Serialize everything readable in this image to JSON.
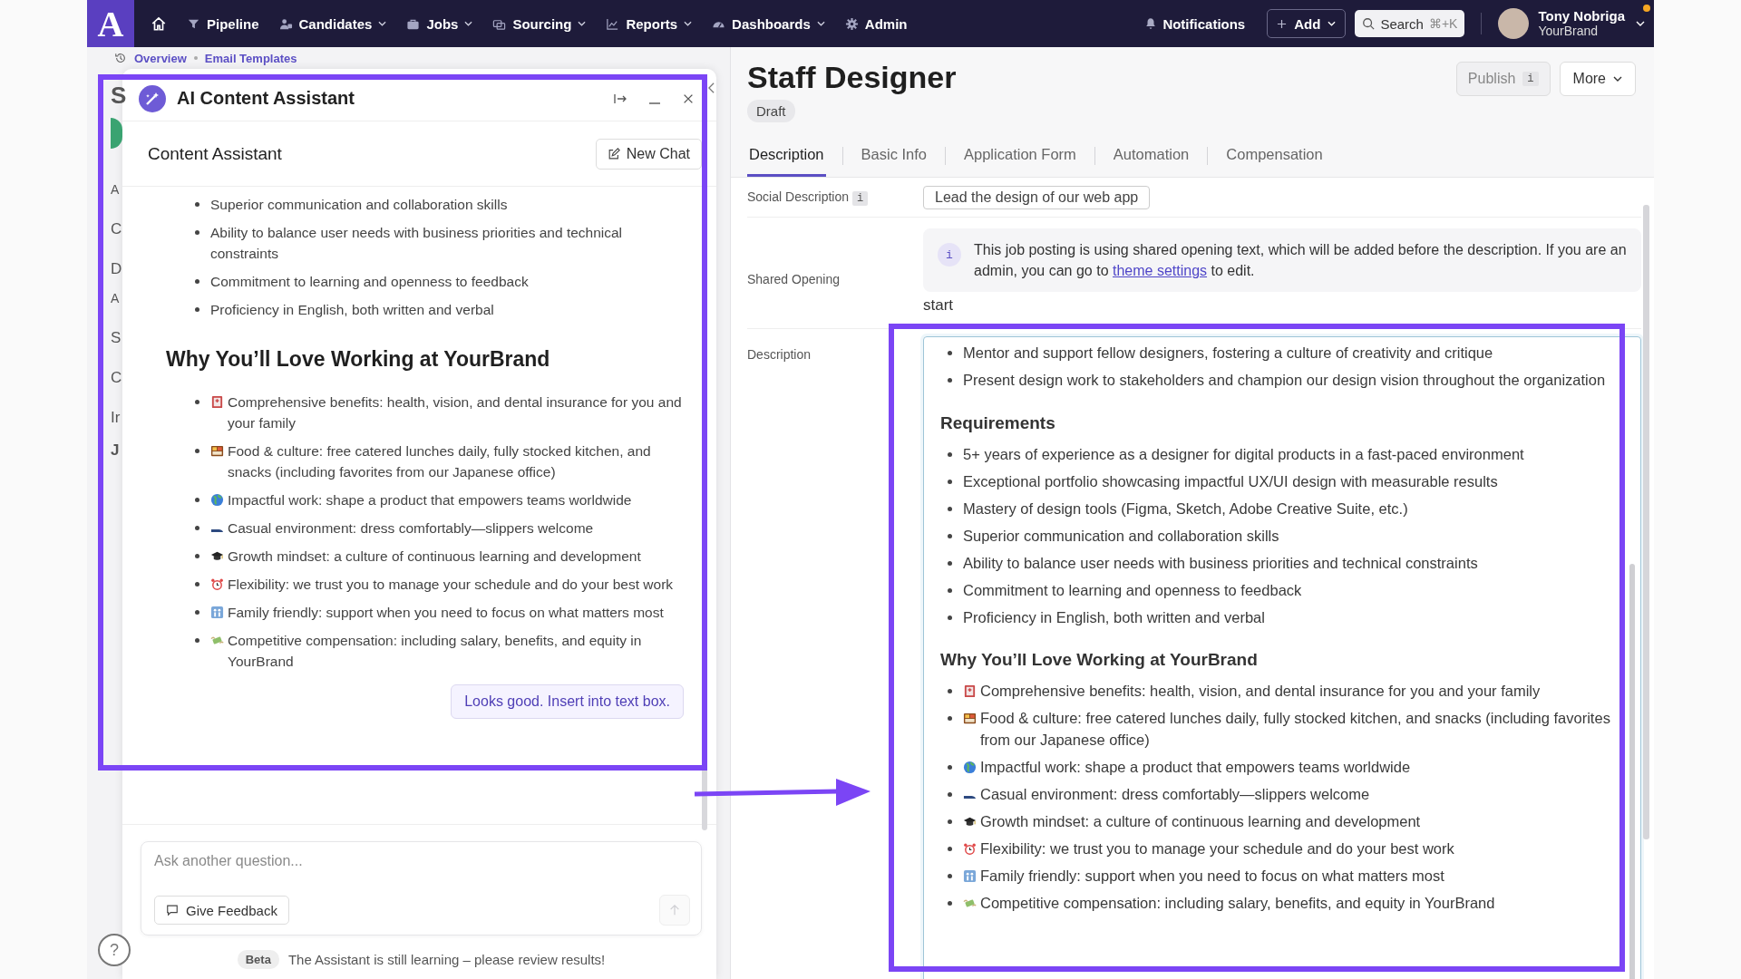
{
  "nav": {
    "logo": "A",
    "items": [
      {
        "label": "Pipeline",
        "dropdown": false
      },
      {
        "label": "Candidates",
        "dropdown": true
      },
      {
        "label": "Jobs",
        "dropdown": true
      },
      {
        "label": "Sourcing",
        "dropdown": true
      },
      {
        "label": "Reports",
        "dropdown": true
      },
      {
        "label": "Dashboards",
        "dropdown": true
      },
      {
        "label": "Admin",
        "dropdown": false
      }
    ],
    "notifications": "Notifications",
    "add": "Add",
    "search": {
      "label": "Search",
      "shortcut": "⌘+K"
    },
    "user": {
      "name": "Tony Nobriga",
      "org": "YourBrand",
      "alert": true
    }
  },
  "breadcrumb": [
    "Overview",
    "Email Templates"
  ],
  "background_fragments": [
    "S",
    "A",
    "C",
    "D",
    "A",
    "S",
    "C",
    "Ir",
    "J"
  ],
  "assistant": {
    "title": "AI Content Assistant",
    "subtitle": "Content Assistant",
    "new_chat": "New Chat",
    "response": [
      {
        "kind": "list",
        "items": [
          "Superior communication and collaboration skills",
          "Ability to balance user needs with business priorities and technical constraints",
          "Commitment to learning and openness to feedback",
          "Proficiency in English, both written and verbal"
        ]
      },
      {
        "kind": "perks",
        "heading": "Why You’ll Love Working at YourBrand",
        "items": [
          "Comprehensive benefits: health, vision, and dental insurance for you and your family",
          "Food & culture: free catered lunches daily, fully stocked kitchen, and snacks (including favorites from our Japanese office)",
          "Impactful work: shape a product that empowers teams worldwide",
          "Casual environment: dress comfortably—slippers welcome",
          "Growth mindset: a culture of continuous learning and development",
          "Flexibility: we trust you to manage your schedule and do your best work",
          "Family friendly: support when you need to focus on what matters most",
          "Competitive compensation: including salary, benefits, and equity in YourBrand"
        ]
      }
    ],
    "user_message": "Looks good. Insert into text box.",
    "input": {
      "placeholder": "Ask another question..."
    },
    "feedback": "Give Feedback",
    "send_disabled": true,
    "beta": "Beta",
    "disclaimer": "The Assistant is still learning – please review results!",
    "help": "?"
  },
  "job": {
    "title": "Staff Designer",
    "status": "Draft",
    "publish": {
      "label": "Publish",
      "info": "i",
      "disabled": true
    },
    "more": "More",
    "tabs": [
      {
        "label": "Description",
        "selected": true
      },
      {
        "label": "Basic Info",
        "selected": false
      },
      {
        "label": "Application Form",
        "selected": false
      },
      {
        "label": "Automation",
        "selected": false
      },
      {
        "label": "Compensation",
        "selected": false
      }
    ],
    "social": {
      "label": "Social Description",
      "info": "i",
      "value": "Lead the design of our web app"
    },
    "shared_opening": {
      "label": "Shared Opening",
      "info": "i",
      "text_before": "This job posting is using shared opening text, which will be added before the description. If you are an admin, you can go to ",
      "link": "theme settings",
      "text_after": " to edit.",
      "start": "start"
    },
    "description": {
      "label": "Description",
      "sections": [
        {
          "kind": "list",
          "items": [
            "Mentor and support fellow designers, fostering a culture of creativity and critique",
            "Present design work to stakeholders and champion our design vision throughout the organization"
          ]
        },
        {
          "kind": "list",
          "heading": "Requirements",
          "items": [
            "5+ years of experience as a designer for digital products in a fast-paced environment",
            "Exceptional portfolio showcasing impactful UX/UI design with measurable results",
            "Mastery of design tools (Figma, Sketch, Adobe Creative Suite, etc.)",
            "Superior communication and collaboration skills",
            "Ability to balance user needs with business priorities and technical constraints",
            "Commitment to learning and openness to feedback",
            "Proficiency in English, both written and verbal"
          ]
        },
        {
          "kind": "perks",
          "heading": "Why You’ll Love Working at YourBrand",
          "items": [
            "Comprehensive benefits: health, vision, and dental insurance for you and your family",
            "Food & culture: free catered lunches daily, fully stocked kitchen, and snacks (including favorites from our Japanese office)",
            "Impactful work: shape a product that empowers teams worldwide",
            "Casual environment: dress comfortably—slippers welcome",
            "Growth mindset: a culture of continuous learning and development",
            "Flexibility: we trust you to manage your schedule and do your best work",
            "Family friendly: support when you need to focus on what matters most",
            "Competitive compensation: including salary, benefits, and equity in YourBrand"
          ]
        }
      ]
    }
  }
}
